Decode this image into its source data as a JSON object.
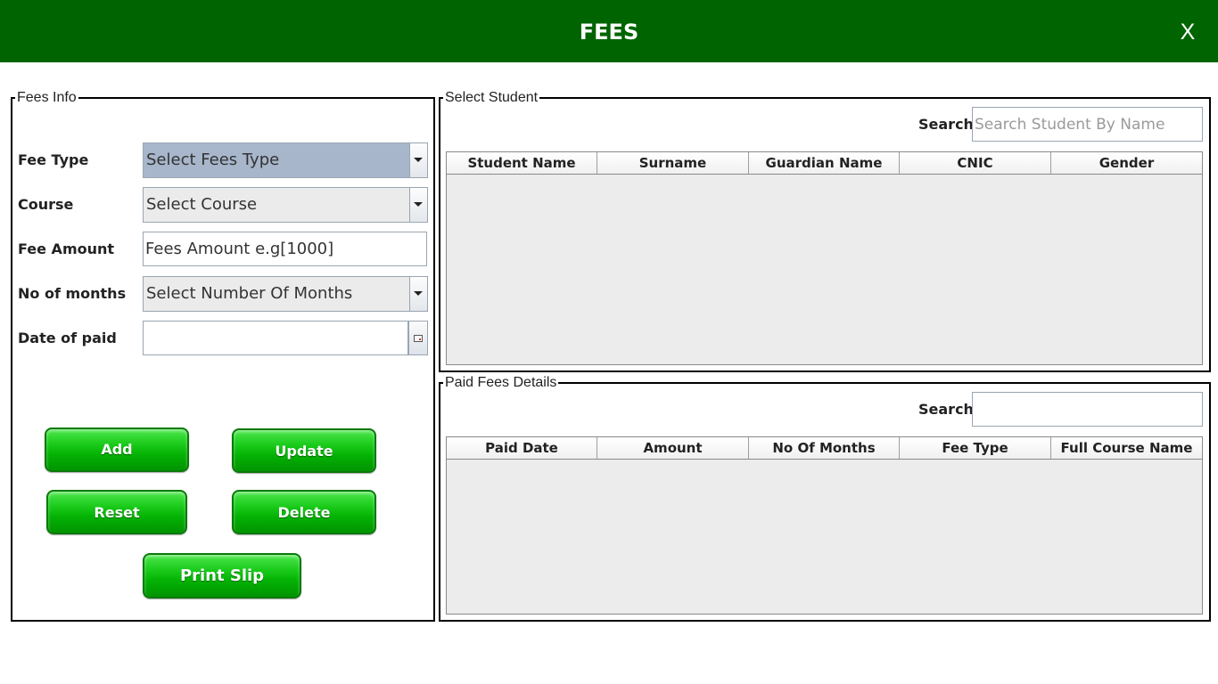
{
  "header": {
    "title": "FEES",
    "close_label": "X",
    "background": "#006400"
  },
  "fees_info": {
    "legend": "Fees Info",
    "fee_type": {
      "label": "Fee Type",
      "value": "Select Fees Type"
    },
    "course": {
      "label": "Course",
      "value": "Select Course"
    },
    "fee_amount": {
      "label": "Fee Amount",
      "placeholder": "Fees Amount e.g[1000]"
    },
    "months": {
      "label": "No of months",
      "value": "Select Number Of Months"
    },
    "date_paid": {
      "label": "Date of paid",
      "value": "",
      "button_icon": "calendar-icon"
    },
    "buttons": {
      "add": "Add",
      "update": "Update",
      "reset": "Reset",
      "delete": "Delete",
      "print": "Print Slip"
    },
    "button_color": "#1ccc1c"
  },
  "select_student": {
    "legend": "Select Student",
    "search_label": "Search",
    "search_placeholder": "Search Student By Name",
    "columns": [
      "Student Name",
      "Surname",
      "Guardian Name",
      "CNIC",
      "Gender"
    ],
    "rows": []
  },
  "paid_fees": {
    "legend": "Paid Fees Details",
    "search_label": "Search",
    "search_placeholder": "",
    "columns": [
      "Paid Date",
      "Amount",
      "No Of Months",
      "Fee Type",
      "Full Course Name"
    ],
    "rows": []
  }
}
